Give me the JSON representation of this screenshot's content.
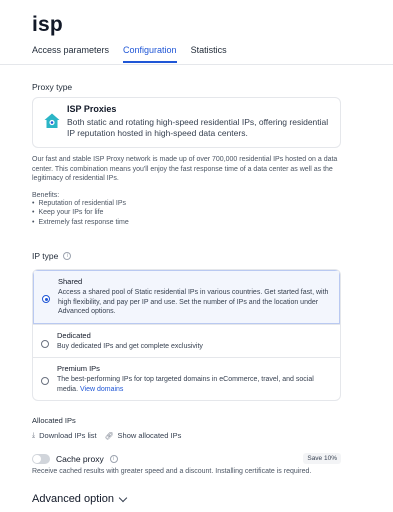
{
  "page_title": "isp",
  "tabs": [
    {
      "label": "Access parameters"
    },
    {
      "label": "Configuration"
    },
    {
      "label": "Statistics"
    }
  ],
  "proxy_type": {
    "label": "Proxy type",
    "card_title": "ISP Proxies",
    "card_desc": "Both static and rotating high-speed residential IPs, offering residential IP reputation hosted in high-speed data centers."
  },
  "description": "Our fast and stable ISP Proxy network is made up of over 700,000 residential IPs hosted on a data center. This combination means you'll enjoy the fast response time of a data center as well as the legitimacy of residential IPs.",
  "benefits": {
    "title": "Benefits:",
    "items": [
      "Reputation of residential IPs",
      "Keep your IPs for life",
      "Extremely fast response time"
    ]
  },
  "ip_type": {
    "label": "IP type",
    "options": [
      {
        "title": "Shared",
        "desc": "Access a shared pool of Static residential IPs in various countries. Get started fast, with high flexibility, and pay per IP and use. Set the number of IPs and the location under Advanced options."
      },
      {
        "title": "Dedicated",
        "desc": "Buy dedicated IPs and get complete exclusivity"
      },
      {
        "title": "Premium IPs",
        "desc": "The best-performing IPs for top targeted domains in eCommerce, travel, and social media.",
        "link": "View domains"
      }
    ]
  },
  "allocated": {
    "label": "Allocated IPs",
    "download": "Download IPs list",
    "show": "Show allocated IPs"
  },
  "cache": {
    "label": "Cache proxy",
    "badge": "Save 10%",
    "desc": "Receive cached results with greater speed and a discount. Installing certificate is required."
  },
  "advanced": {
    "label": "Advanced option"
  },
  "colors": {
    "accent": "#1f56d6",
    "selected_bg": "#f3f6fd",
    "icon_teal": "#2bb5c6"
  }
}
